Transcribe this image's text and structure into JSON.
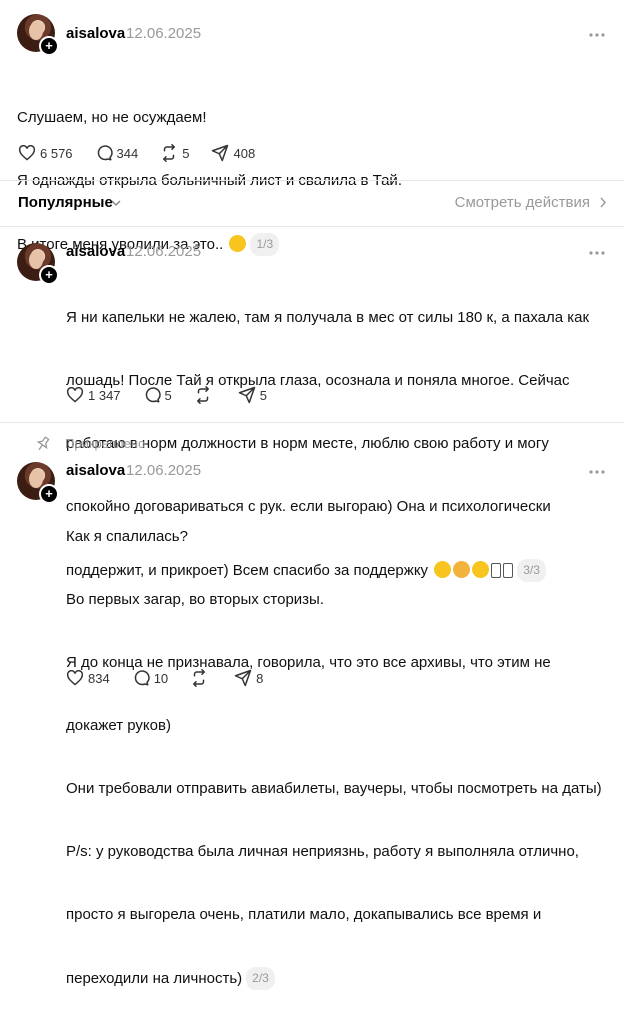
{
  "posts": [
    {
      "username": "aisalova",
      "date": "12.06.2025",
      "lines": [
        "Слушаем, но не осуждаем!",
        "Я однажды открыла больничный лист и свалила в Тай.",
        "В итоге меня уволили за это.."
      ],
      "thread_counter": "1/3",
      "actions": {
        "likes": "6 576",
        "replies": "344",
        "reposts": "5",
        "shares": "408"
      }
    },
    {
      "username": "aisalova",
      "date": "12.06.2025",
      "lines": [
        "Я ни капельки не жалею, там я получала в мес от силы 180 к, а пахала как",
        "лошадь! После Тай я открыла глаза, осознала и поняла многое. Сейчас",
        "работаю в норм должности в норм месте, люблю свою работу и могу",
        "спокойно договариваться с рук. если выгораю) Она и психологически",
        "поддержит, и прикроет) Всем спасибо за поддержку"
      ],
      "thread_counter": "3/3",
      "actions": {
        "likes": "1 347",
        "replies": "5",
        "reposts": "",
        "shares": "5"
      }
    },
    {
      "username": "aisalova",
      "date": "12.06.2025",
      "lines": [
        "Как я спалилась?",
        "Во первых загар, во вторых сторизы.",
        "Я до конца не признавала, говорила, что это все архивы, что этим не",
        "докажет руков)",
        "Они требовали отправить авиабилеты, ваучеры, чтобы посмотреть на даты)",
        "P/s: у руководства была личная неприязнь, работу я выполняла отлично,",
        "просто я выгорела очень, платили мало, докапывались все время и",
        "переходили на личность)"
      ],
      "thread_counter": "2/3",
      "actions": {
        "likes": "834",
        "replies": "10",
        "reposts": "",
        "shares": "8"
      }
    }
  ],
  "filter": {
    "label": "Популярные",
    "view_activity": "Смотреть действия"
  },
  "pinned_label": "Прикреплено",
  "colors": {
    "muted": "#999999",
    "divider": "#e6e6e6",
    "badge_bg": "#f0f0f0"
  }
}
